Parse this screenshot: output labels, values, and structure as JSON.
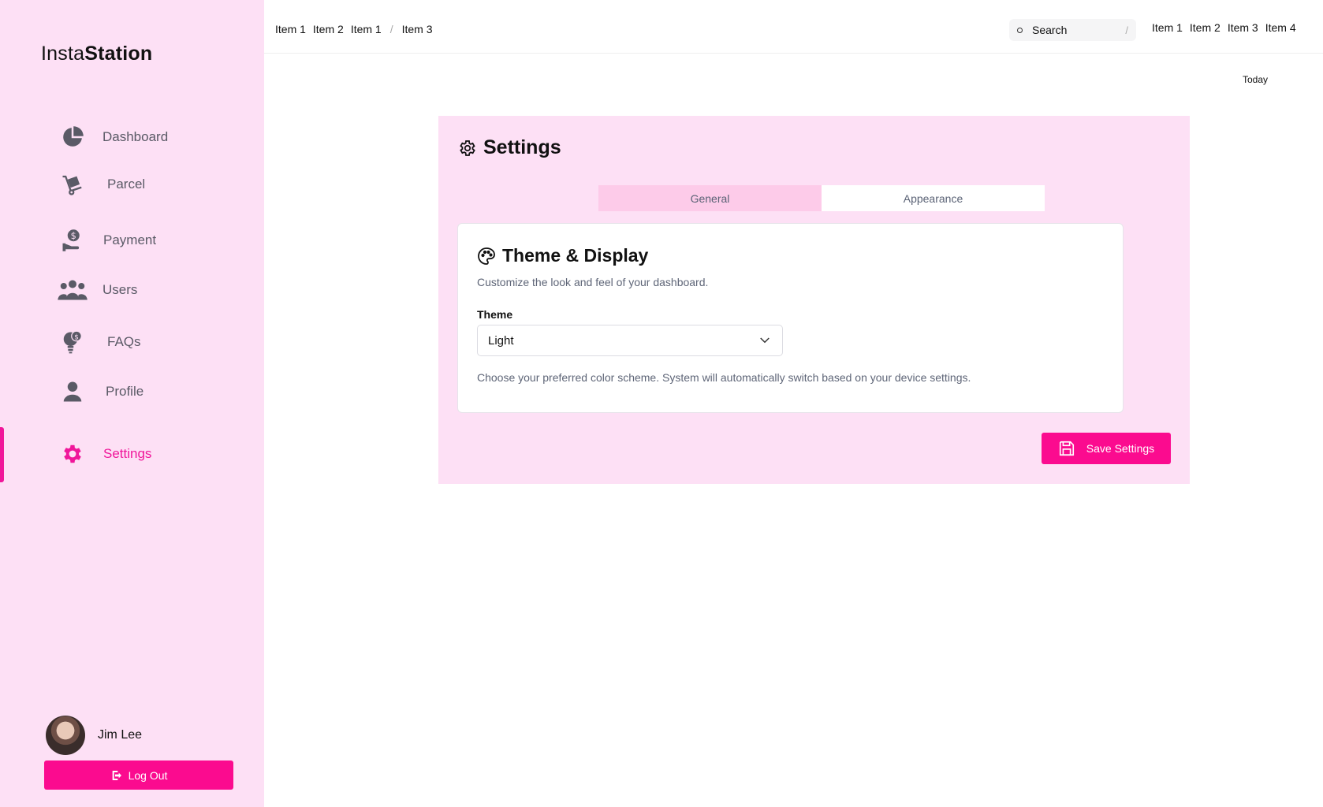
{
  "sidebar": {
    "logo_regular": "Insta",
    "logo_bold": "Station",
    "items": [
      {
        "label": "Dashboard",
        "icon": "pie-chart-icon"
      },
      {
        "label": "Parcel",
        "icon": "hand-truck-icon"
      },
      {
        "label": "Payment",
        "icon": "hand-coin-icon"
      },
      {
        "label": "Users",
        "icon": "users-icon"
      },
      {
        "label": "FAQs",
        "icon": "lightbulb-dollar-icon"
      },
      {
        "label": "Profile",
        "icon": "person-icon"
      },
      {
        "label": "Settings",
        "icon": "gear-icon",
        "active": true
      }
    ],
    "user_name": "Jim Lee",
    "logout_label": "Log Out"
  },
  "header": {
    "breadcrumbs": [
      "Item 1",
      "Item 2",
      "Item 1",
      "Item 3"
    ],
    "search_placeholder": "Search",
    "search_shortcut": "/",
    "nav": [
      "Item 1",
      "Item 2",
      "Item 3",
      "Item 4"
    ],
    "date_label": "Today"
  },
  "settings": {
    "title": "Settings",
    "tabs": [
      {
        "label": "General",
        "active": true
      },
      {
        "label": "Appearance"
      }
    ],
    "card": {
      "title": "Theme & Display",
      "description": "Customize the look and feel of your dashboard.",
      "field_label": "Theme",
      "selected_value": "Light",
      "help_text": "Choose your preferred color scheme. System will automatically switch based on your device settings."
    },
    "save_label": "Save Settings"
  },
  "colors": {
    "accent": "#fb0b8f",
    "sidebar_bg": "#fde0f5",
    "active_tab_bg": "#fdcbe9"
  }
}
